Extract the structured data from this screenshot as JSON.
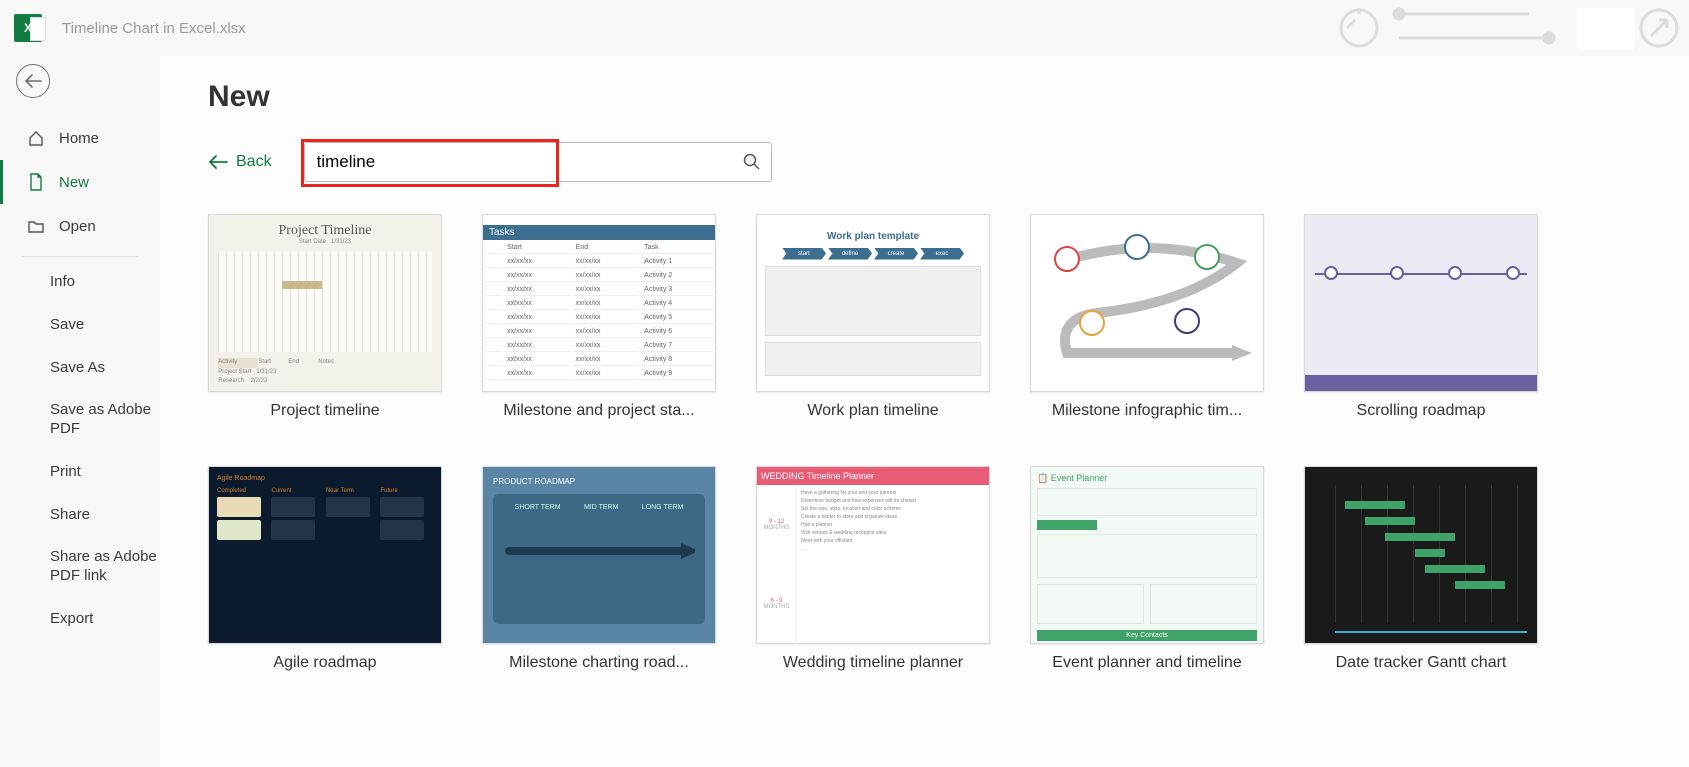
{
  "titlebar": {
    "app_icon_letter": "X",
    "file_title": "Timeline Chart in Excel.xlsx"
  },
  "nav": {
    "home": "Home",
    "new": "New",
    "open": "Open",
    "subs": [
      "Info",
      "Save",
      "Save As",
      "Save as Adobe PDF",
      "Print",
      "Share",
      "Share as Adobe PDF link",
      "Export"
    ]
  },
  "page": {
    "title": "New",
    "back_label": "Back",
    "search_value": "timeline"
  },
  "templates": [
    {
      "label": "Project timeline"
    },
    {
      "label": "Milestone and project sta..."
    },
    {
      "label": "Work plan timeline"
    },
    {
      "label": "Milestone infographic tim..."
    },
    {
      "label": "Scrolling roadmap"
    },
    {
      "label": "Agile roadmap"
    },
    {
      "label": "Milestone charting road..."
    },
    {
      "label": "Wedding timeline planner"
    },
    {
      "label": "Event planner and timeline"
    },
    {
      "label": "Date tracker Gantt chart"
    }
  ]
}
